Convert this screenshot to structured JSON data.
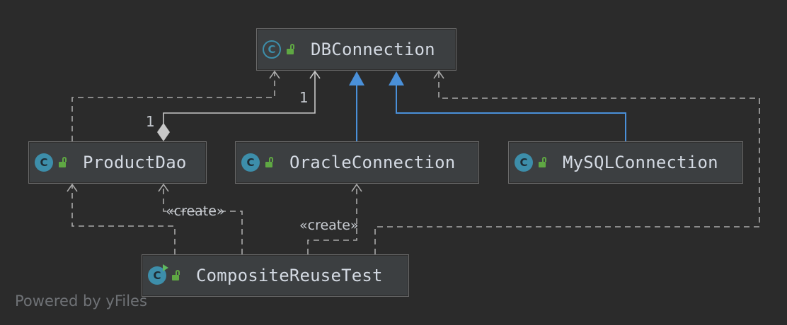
{
  "diagram": {
    "nodes": {
      "db_connection": {
        "title": "DBConnection",
        "icon": "abstract-class-icon",
        "visibility": "public"
      },
      "product_dao": {
        "title": "ProductDao",
        "icon": "class-icon",
        "visibility": "public"
      },
      "oracle_connection": {
        "title": "OracleConnection",
        "icon": "class-icon",
        "visibility": "public"
      },
      "mysql_connection": {
        "title": "MySQLConnection",
        "icon": "class-icon",
        "visibility": "public"
      },
      "composite_reuse_test": {
        "title": "CompositeReuseTest",
        "icon": "runnable-class-icon",
        "visibility": "public"
      }
    },
    "icon_letters": {
      "class": "C"
    },
    "edge_labels": {
      "composition_source_multiplicity": "1",
      "composition_target_multiplicity": "1",
      "create_product_dao": "«create»",
      "create_oracle_connection": "«create»"
    },
    "colors": {
      "background": "#2b2b2b",
      "node_fill": "#3c3f41",
      "inheritance_edge": "#4a90d9",
      "dependency_edge": "#a9a9a9",
      "class_icon": "#3d8eaa",
      "public_lock": "#5fa843"
    }
  },
  "footer": {
    "watermark": "Powered by yFiles"
  }
}
